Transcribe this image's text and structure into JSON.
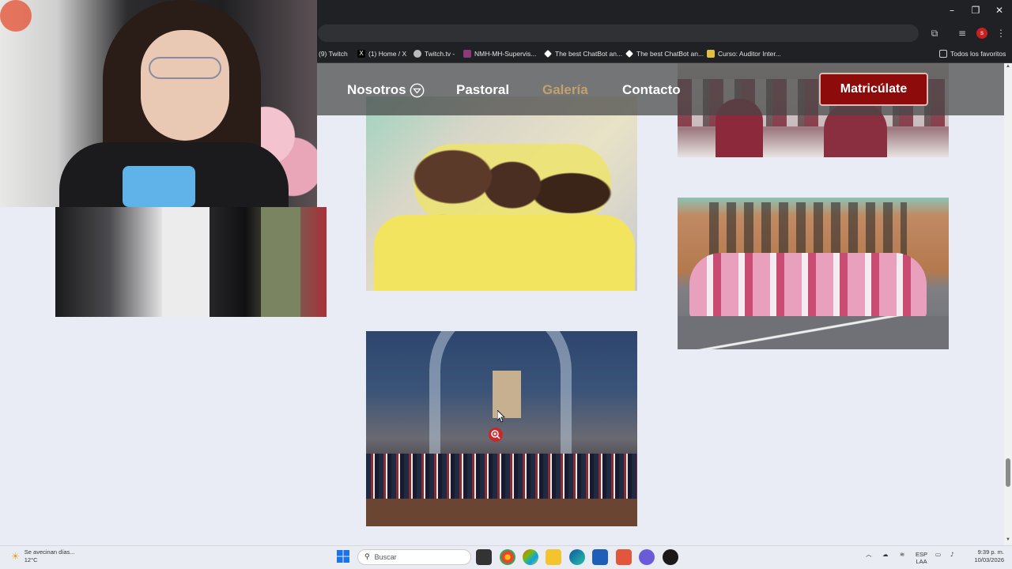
{
  "browser": {
    "bookmarks": [
      {
        "label": "(9) Twitch",
        "color": "#9146ff"
      },
      {
        "label": "(1) Home / X",
        "color": "#000000"
      },
      {
        "label": "Twitch.tv -",
        "color": "#cccccc"
      },
      {
        "label": "NMH-MH-Supervis...",
        "color": "#8a3b7a"
      },
      {
        "label": "The best ChatBot an...",
        "color": "#ffffff"
      },
      {
        "label": "The best ChatBot an...",
        "color": "#ffffff"
      },
      {
        "label": "Curso: Auditor Inter...",
        "color": "#e0c040"
      }
    ],
    "all_bookmarks_label": "Todos los favoritos",
    "profile_initial": "s"
  },
  "site": {
    "nav": {
      "nosotros": "Nosotros",
      "pastoral": "Pastoral",
      "galeria": "Galería",
      "contacto": "Contacto",
      "cta": "Matricúlate"
    },
    "colors": {
      "accent_brand": "#8e0b0b",
      "active_nav": "#c3a06c"
    }
  },
  "taskbar": {
    "weather_line1": "Se avecinan días...",
    "weather_line2": "12°C",
    "search_placeholder": "Buscar",
    "lang_line1": "ESP",
    "lang_line2": "LAA",
    "time": "9:39 p. m.",
    "date": "10/03/2026"
  }
}
